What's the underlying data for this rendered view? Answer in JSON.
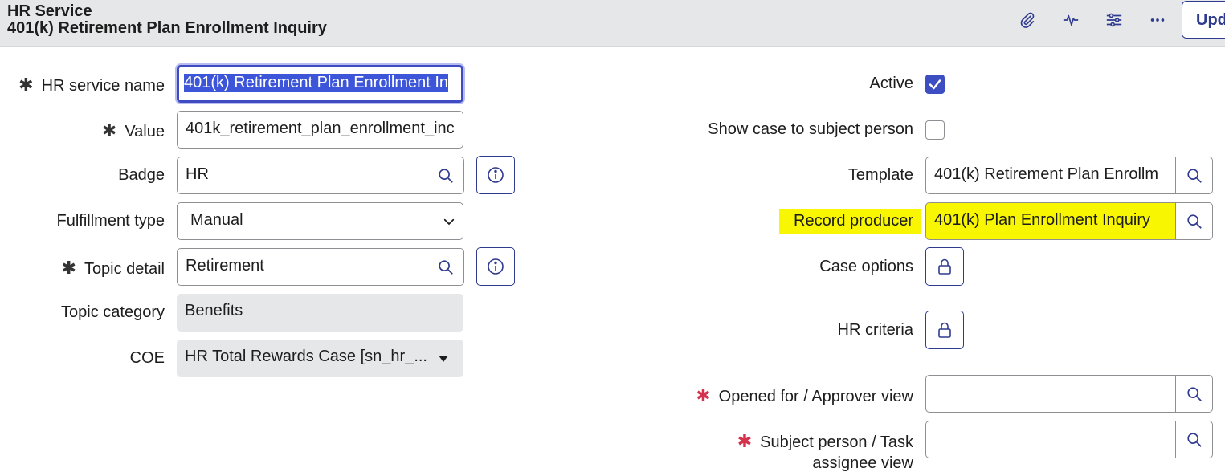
{
  "header": {
    "record_type": "HR Service",
    "record_name": "401(k) Retirement Plan Enrollment Inquiry",
    "icons": [
      "paperclip-icon",
      "activity-icon",
      "settings-sliders-icon",
      "more-icon"
    ],
    "update_label": "Upd"
  },
  "left": {
    "hr_service_name": {
      "label": "HR service name",
      "value": "401(k) Retirement Plan Enrollment In"
    },
    "value": {
      "label": "Value",
      "value": "401k_retirement_plan_enrollment_inc"
    },
    "badge": {
      "label": "Badge",
      "value": "HR"
    },
    "fulfillment_type": {
      "label": "Fulfillment type",
      "value": "Manual"
    },
    "topic_detail": {
      "label": "Topic detail",
      "value": "Retirement"
    },
    "topic_category": {
      "label": "Topic category",
      "value": "Benefits"
    },
    "coe": {
      "label": "COE",
      "value": "HR Total Rewards Case [sn_hr_..."
    }
  },
  "right": {
    "active": {
      "label": "Active",
      "checked": true
    },
    "show_case": {
      "label": "Show case to subject person",
      "checked": false
    },
    "template": {
      "label": "Template",
      "value": "401(k) Retirement Plan Enrollm"
    },
    "record_producer": {
      "label": "Record producer",
      "value": "401(k) Plan Enrollment Inquiry"
    },
    "case_options": {
      "label": "Case options"
    },
    "hr_criteria": {
      "label": "HR criteria"
    },
    "opened_for": {
      "label": "Opened for / Approver view",
      "value": ""
    },
    "subject_person": {
      "label_line1": "Subject person / Task",
      "label_line2": "assignee view",
      "value": ""
    }
  },
  "colors": {
    "accent": "#3d4ec2",
    "highlight": "#f8f600",
    "required_red": "#d5334d"
  }
}
